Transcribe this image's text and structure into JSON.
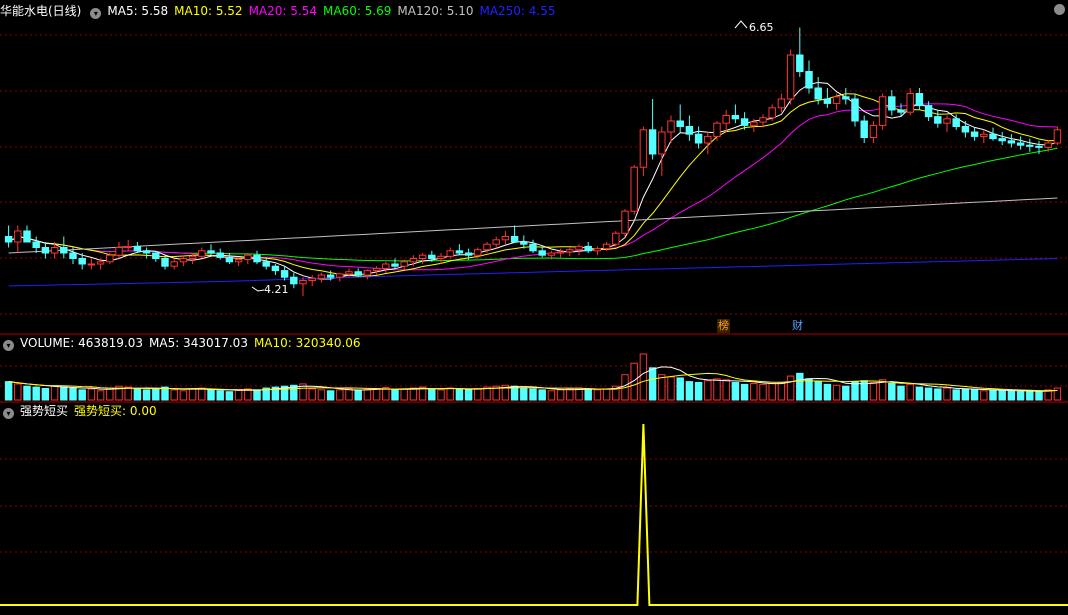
{
  "header": {
    "stock_title": "华能水电(日线)",
    "ma_items": [
      {
        "label": "MA5: 5.58",
        "color": "#ffffff"
      },
      {
        "label": "MA10: 5.52",
        "color": "#ffff00"
      },
      {
        "label": "MA20: 5.54",
        "color": "#ff00ff"
      },
      {
        "label": "MA60: 5.69",
        "color": "#00ff00"
      },
      {
        "label": "MA120: 5.10",
        "color": "#c0c0c0"
      },
      {
        "label": "MA250: 4.55",
        "color": "#2020ff"
      }
    ]
  },
  "volume_header": {
    "volume": "VOLUME: 463819.03",
    "ma5": "MA5: 343017.03",
    "ma10": "MA10: 320340.06"
  },
  "indicator_header": {
    "name": "强势短买",
    "value_label": "强势短买: 0.00"
  },
  "badges": {
    "bang": "榜",
    "cai": "财"
  },
  "colors": {
    "up": "#ff3232",
    "down": "#54ffff",
    "grid": "#8b0000",
    "divider": "#b00000"
  },
  "chart_data": {
    "type": "candlestick",
    "annotations": {
      "high": "6.65",
      "low": "4.21"
    },
    "candles": [
      [
        4.75,
        4.85,
        4.65,
        4.7
      ],
      [
        4.7,
        4.85,
        4.6,
        4.8
      ],
      [
        4.8,
        4.85,
        4.7,
        4.7
      ],
      [
        4.7,
        4.75,
        4.6,
        4.65
      ],
      [
        4.65,
        4.7,
        4.55,
        4.6
      ],
      [
        4.6,
        4.7,
        4.55,
        4.65
      ],
      [
        4.65,
        4.75,
        4.55,
        4.6
      ],
      [
        4.6,
        4.65,
        4.5,
        4.55
      ],
      [
        4.55,
        4.6,
        4.45,
        4.5
      ],
      [
        4.5,
        4.55,
        4.45,
        4.5
      ],
      [
        4.5,
        4.55,
        4.45,
        4.52
      ],
      [
        4.52,
        4.6,
        4.5,
        4.58
      ],
      [
        4.58,
        4.7,
        4.55,
        4.65
      ],
      [
        4.65,
        4.72,
        4.62,
        4.66
      ],
      [
        4.66,
        4.7,
        4.6,
        4.62
      ],
      [
        4.62,
        4.65,
        4.55,
        4.6
      ],
      [
        4.6,
        4.62,
        4.52,
        4.55
      ],
      [
        4.55,
        4.58,
        4.45,
        4.48
      ],
      [
        4.48,
        4.55,
        4.45,
        4.52
      ],
      [
        4.52,
        4.58,
        4.48,
        4.55
      ],
      [
        4.55,
        4.6,
        4.5,
        4.57
      ],
      [
        4.57,
        4.65,
        4.55,
        4.62
      ],
      [
        4.62,
        4.68,
        4.58,
        4.6
      ],
      [
        4.6,
        4.64,
        4.54,
        4.56
      ],
      [
        4.56,
        4.6,
        4.5,
        4.52
      ],
      [
        4.52,
        4.56,
        4.48,
        4.54
      ],
      [
        4.54,
        4.6,
        4.5,
        4.58
      ],
      [
        4.58,
        4.62,
        4.5,
        4.52
      ],
      [
        4.52,
        4.55,
        4.45,
        4.48
      ],
      [
        4.48,
        4.5,
        4.4,
        4.44
      ],
      [
        4.44,
        4.48,
        4.35,
        4.38
      ],
      [
        4.38,
        4.42,
        4.28,
        4.32
      ],
      [
        4.32,
        4.38,
        4.21,
        4.35
      ],
      [
        4.35,
        4.4,
        4.3,
        4.37
      ],
      [
        4.37,
        4.42,
        4.33,
        4.4
      ],
      [
        4.4,
        4.44,
        4.35,
        4.38
      ],
      [
        4.38,
        4.42,
        4.34,
        4.41
      ],
      [
        4.41,
        4.46,
        4.38,
        4.43
      ],
      [
        4.43,
        4.46,
        4.38,
        4.4
      ],
      [
        4.4,
        4.45,
        4.36,
        4.44
      ],
      [
        4.44,
        4.48,
        4.4,
        4.46
      ],
      [
        4.46,
        4.52,
        4.42,
        4.5
      ],
      [
        4.5,
        4.55,
        4.46,
        4.48
      ],
      [
        4.48,
        4.54,
        4.45,
        4.52
      ],
      [
        4.52,
        4.58,
        4.48,
        4.55
      ],
      [
        4.55,
        4.6,
        4.5,
        4.58
      ],
      [
        4.58,
        4.62,
        4.52,
        4.55
      ],
      [
        4.55,
        4.6,
        4.5,
        4.57
      ],
      [
        4.57,
        4.65,
        4.55,
        4.62
      ],
      [
        4.62,
        4.68,
        4.58,
        4.6
      ],
      [
        4.6,
        4.64,
        4.54,
        4.58
      ],
      [
        4.58,
        4.65,
        4.55,
        4.63
      ],
      [
        4.63,
        4.7,
        4.6,
        4.68
      ],
      [
        4.68,
        4.75,
        4.64,
        4.72
      ],
      [
        4.72,
        4.8,
        4.68,
        4.75
      ],
      [
        4.75,
        4.85,
        4.7,
        4.7
      ],
      [
        4.7,
        4.76,
        4.64,
        4.68
      ],
      [
        4.68,
        4.72,
        4.6,
        4.62
      ],
      [
        4.62,
        4.66,
        4.56,
        4.58
      ],
      [
        4.58,
        4.62,
        4.54,
        4.6
      ],
      [
        4.6,
        4.64,
        4.56,
        4.61
      ],
      [
        4.61,
        4.65,
        4.57,
        4.63
      ],
      [
        4.63,
        4.68,
        4.58,
        4.66
      ],
      [
        4.66,
        4.7,
        4.6,
        4.62
      ],
      [
        4.62,
        4.66,
        4.58,
        4.64
      ],
      [
        4.64,
        4.7,
        4.62,
        4.68
      ],
      [
        4.68,
        4.8,
        4.66,
        4.78
      ],
      [
        4.78,
        5.0,
        4.75,
        4.98
      ],
      [
        4.98,
        5.4,
        4.95,
        5.38
      ],
      [
        5.38,
        5.75,
        5.3,
        5.72
      ],
      [
        5.72,
        6.0,
        5.45,
        5.5
      ],
      [
        5.5,
        5.75,
        5.3,
        5.7
      ],
      [
        5.7,
        5.85,
        5.6,
        5.8
      ],
      [
        5.8,
        5.95,
        5.7,
        5.75
      ],
      [
        5.75,
        5.85,
        5.62,
        5.68
      ],
      [
        5.68,
        5.75,
        5.55,
        5.6
      ],
      [
        5.6,
        5.7,
        5.5,
        5.66
      ],
      [
        5.66,
        5.8,
        5.62,
        5.78
      ],
      [
        5.78,
        5.9,
        5.7,
        5.85
      ],
      [
        5.85,
        5.95,
        5.78,
        5.82
      ],
      [
        5.82,
        5.88,
        5.72,
        5.76
      ],
      [
        5.76,
        5.82,
        5.7,
        5.79
      ],
      [
        5.79,
        5.86,
        5.74,
        5.83
      ],
      [
        5.83,
        5.95,
        5.8,
        5.92
      ],
      [
        5.92,
        6.05,
        5.88,
        6.0
      ],
      [
        6.0,
        6.45,
        5.95,
        6.4
      ],
      [
        6.4,
        6.65,
        6.2,
        6.25
      ],
      [
        6.25,
        6.35,
        6.05,
        6.1
      ],
      [
        6.1,
        6.2,
        5.95,
        6.0
      ],
      [
        6.0,
        6.1,
        5.92,
        5.96
      ],
      [
        5.96,
        6.05,
        5.9,
        6.02
      ],
      [
        6.02,
        6.1,
        5.95,
        6.0
      ],
      [
        6.0,
        6.05,
        5.75,
        5.8
      ],
      [
        5.8,
        5.85,
        5.6,
        5.65
      ],
      [
        5.65,
        5.8,
        5.6,
        5.76
      ],
      [
        5.76,
        6.05,
        5.72,
        6.02
      ],
      [
        6.02,
        6.08,
        5.85,
        5.9
      ],
      [
        5.9,
        5.96,
        5.84,
        5.88
      ],
      [
        5.88,
        6.1,
        5.85,
        6.05
      ],
      [
        6.05,
        6.1,
        5.9,
        5.94
      ],
      [
        5.94,
        5.98,
        5.8,
        5.84
      ],
      [
        5.84,
        5.9,
        5.74,
        5.78
      ],
      [
        5.78,
        5.85,
        5.7,
        5.82
      ],
      [
        5.82,
        5.86,
        5.72,
        5.75
      ],
      [
        5.75,
        5.8,
        5.65,
        5.7
      ],
      [
        5.7,
        5.74,
        5.62,
        5.66
      ],
      [
        5.66,
        5.72,
        5.6,
        5.68
      ],
      [
        5.68,
        5.74,
        5.62,
        5.64
      ],
      [
        5.64,
        5.7,
        5.58,
        5.62
      ],
      [
        5.62,
        5.68,
        5.56,
        5.6
      ],
      [
        5.6,
        5.66,
        5.54,
        5.58
      ],
      [
        5.58,
        5.64,
        5.52,
        5.57
      ],
      [
        5.57,
        5.62,
        5.5,
        5.56
      ],
      [
        5.56,
        5.62,
        5.52,
        5.6
      ],
      [
        5.6,
        5.75,
        5.58,
        5.72
      ]
    ],
    "volume": [
      0.4,
      0.35,
      0.3,
      0.28,
      0.25,
      0.3,
      0.28,
      0.25,
      0.22,
      0.24,
      0.2,
      0.26,
      0.3,
      0.28,
      0.24,
      0.22,
      0.25,
      0.28,
      0.22,
      0.2,
      0.24,
      0.26,
      0.22,
      0.2,
      0.18,
      0.21,
      0.24,
      0.22,
      0.26,
      0.28,
      0.3,
      0.32,
      0.35,
      0.24,
      0.22,
      0.2,
      0.22,
      0.24,
      0.21,
      0.23,
      0.25,
      0.27,
      0.22,
      0.24,
      0.26,
      0.28,
      0.24,
      0.22,
      0.26,
      0.24,
      0.22,
      0.25,
      0.28,
      0.3,
      0.32,
      0.3,
      0.26,
      0.24,
      0.22,
      0.2,
      0.22,
      0.24,
      0.26,
      0.24,
      0.22,
      0.24,
      0.3,
      0.55,
      0.8,
      1.0,
      0.7,
      0.55,
      0.5,
      0.48,
      0.4,
      0.38,
      0.42,
      0.46,
      0.44,
      0.38,
      0.34,
      0.36,
      0.34,
      0.36,
      0.38,
      0.52,
      0.58,
      0.46,
      0.4,
      0.34,
      0.32,
      0.3,
      0.4,
      0.42,
      0.38,
      0.44,
      0.36,
      0.3,
      0.34,
      0.28,
      0.26,
      0.24,
      0.26,
      0.22,
      0.24,
      0.22,
      0.2,
      0.22,
      0.2,
      0.19,
      0.18,
      0.2,
      0.18,
      0.22,
      0.26
    ],
    "ma120": [
      4.6,
      4.7,
      4.8,
      4.9,
      5.0,
      5.1
    ],
    "ma250": [
      4.3,
      4.34,
      4.4,
      4.45,
      4.5,
      4.55
    ],
    "indicator": {
      "spike_index": 69,
      "value": 0.0
    }
  }
}
